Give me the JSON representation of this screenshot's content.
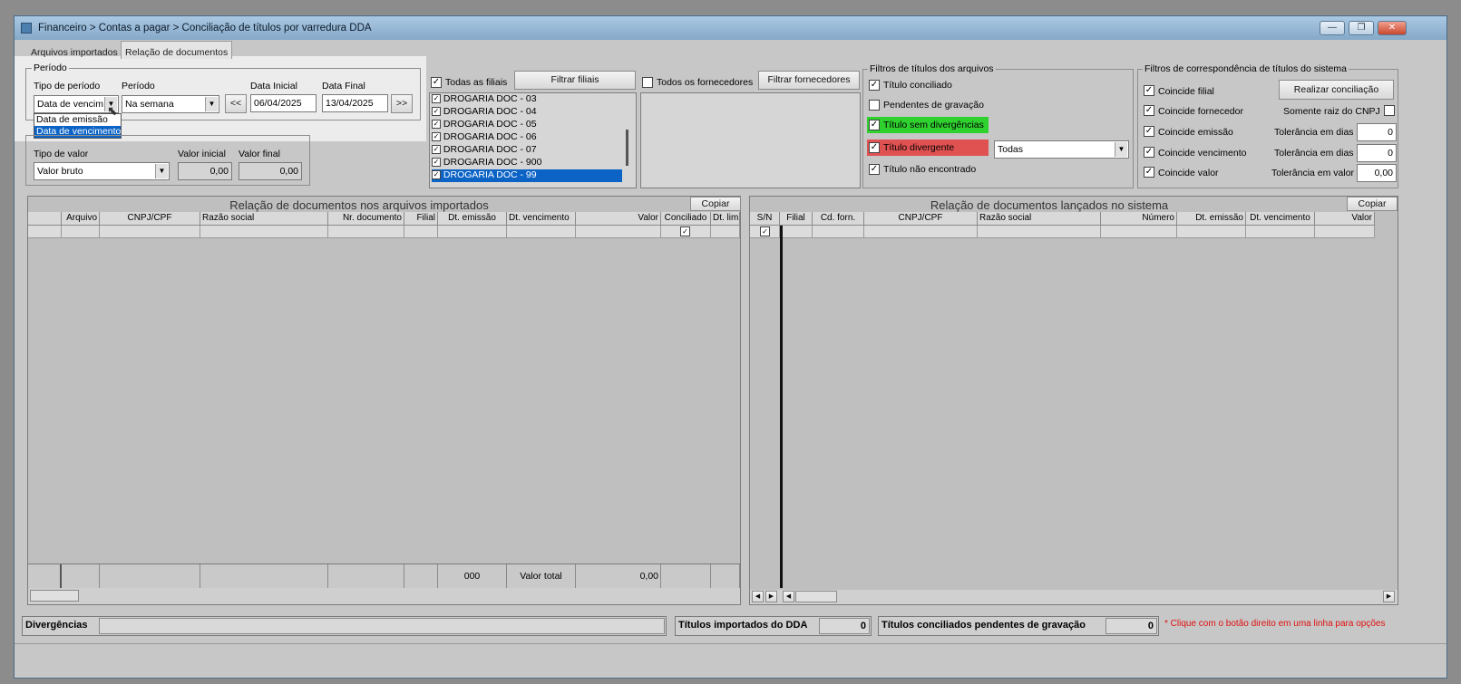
{
  "window": {
    "title": "Financeiro > Contas a pagar > Conciliação de títulos por varredura DDA",
    "minimize": "—",
    "maximize": "❐",
    "close": "✕"
  },
  "tabs": [
    "Arquivos importados",
    "Relação de documentos"
  ],
  "periodo": {
    "legend": "Período",
    "tipo_label": "Tipo de período",
    "tipo_value": "Data de vencim",
    "periodo_label": "Período",
    "periodo_value": "Na semana",
    "data_inicial_label": "Data Inicial",
    "data_inicial": "06/04/2025",
    "data_final_label": "Data Final",
    "data_final": "13/04/2025",
    "prev": "<<",
    "next": ">>",
    "dropdown_options": [
      "Data de emissão",
      "Data de vencimento"
    ],
    "dropdown_selected_index": 1
  },
  "valor": {
    "tipo_label": "Tipo de valor",
    "tipo_value": "Valor bruto",
    "inicial_label": "Valor inicial",
    "inicial": "0,00",
    "final_label": "Valor final",
    "final": "0,00"
  },
  "filiais": {
    "todas_label": "Todas as filiais",
    "todas_checked": true,
    "button": "Filtrar filiais",
    "items": [
      "DROGARIA DOC - 03",
      "DROGARIA DOC - 04",
      "DROGARIA DOC - 05",
      "DROGARIA DOC - 06",
      "DROGARIA DOC - 07",
      "DROGARIA DOC - 900",
      "DROGARIA DOC - 99"
    ],
    "selected_index": 6
  },
  "fornecedores": {
    "todos_label": "Todos os fornecedores",
    "todos_checked": false,
    "button": "Filtrar fornecedores"
  },
  "filtros_arquivos": {
    "legend": "Filtros de títulos dos arquivos",
    "items": [
      {
        "label": "Título conciliado",
        "checked": true,
        "bg": ""
      },
      {
        "label": "Pendentes de gravação",
        "checked": false,
        "bg": ""
      },
      {
        "label": "Título sem divergências",
        "checked": true,
        "bg": "#2fd12f"
      },
      {
        "label": "Título divergente",
        "checked": true,
        "bg": "#e05252"
      },
      {
        "label": "Título não encontrado",
        "checked": true,
        "bg": ""
      }
    ],
    "divergente_combo": "Todas"
  },
  "filtros_sistema": {
    "legend": "Filtros de correspondência de títulos do sistema",
    "items": [
      {
        "label": "Coincide filial",
        "checked": true
      },
      {
        "label": "Coincide fornecedor",
        "checked": true
      },
      {
        "label": "Coincide emissão",
        "checked": true
      },
      {
        "label": "Coincide vencimento",
        "checked": true
      },
      {
        "label": "Coincide valor",
        "checked": true
      }
    ],
    "realizar_button": "Realizar conciliação",
    "somente_raiz_label": "Somente raiz do CNPJ",
    "somente_raiz_checked": false,
    "tolerancia_dias_label": "Tolerância em dias",
    "tolerancia_emissao": "0",
    "tolerancia_vencimento": "0",
    "tolerancia_valor_label": "Tolerância em valor",
    "tolerancia_valor": "0,00"
  },
  "grid_left": {
    "title": "Relação de documentos nos arquivos importados",
    "copy": "Copiar",
    "columns": [
      "Arquivo",
      "CNPJ/CPF",
      "Razão social",
      "Nr. documento",
      "Filial",
      "Dt. emissão",
      "Dt. vencimento",
      "Valor",
      "Conciliado",
      "Dt. lim"
    ],
    "footer_count": "000",
    "footer_total_label": "Valor total",
    "footer_total": "0,00"
  },
  "grid_right": {
    "title": "Relação de documentos lançados no sistema",
    "copy": "Copiar",
    "columns": [
      "S/N",
      "Filial",
      "Cd. forn.",
      "CNPJ/CPF",
      "Razão social",
      "Número",
      "Dt. emissão",
      "Dt. vencimento",
      "Valor"
    ]
  },
  "status": {
    "divergencias_label": "Divergências",
    "importados_label": "Títulos importados do DDA",
    "importados_value": "0",
    "pendentes_label": "Títulos conciliados pendentes de gravação",
    "pendentes_value": "0",
    "hint": "* Clique com o botão direito em uma linha para opções",
    "hint_color": "#e01010"
  }
}
